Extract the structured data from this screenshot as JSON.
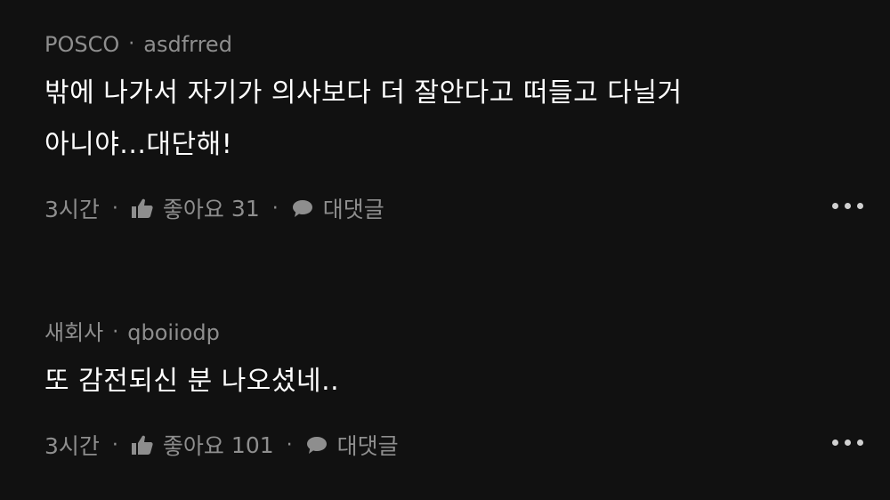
{
  "comments": [
    {
      "org": "POSCO",
      "separator": "·",
      "username": "asdfrred",
      "text_line1": "밖에 나가서 자기가 의사보다 더 잘안다고 떠들고 다닐거",
      "text_line2": "아니야...대단해!",
      "time": "3시간",
      "like_label": "좋아요",
      "like_count": "31",
      "reply_label": "대댓글",
      "like_icon": "thumbs-up-icon",
      "reply_icon": "speech-bubble-icon",
      "more_icon": "more-dots-icon"
    },
    {
      "org": "새회사",
      "separator": "·",
      "username": "qboiiodp",
      "text_line1": "또 감전되신 분 나오셨네..",
      "time": "3시간",
      "like_label": "좋아요",
      "like_count": "101",
      "reply_label": "대댓글",
      "like_icon": "thumbs-up-icon",
      "reply_icon": "speech-bubble-icon",
      "more_icon": "more-dots-icon"
    }
  ],
  "bullet": "·",
  "colors": {
    "background": "#111111",
    "text": "#ffffff",
    "muted": "#8e8e8e"
  }
}
